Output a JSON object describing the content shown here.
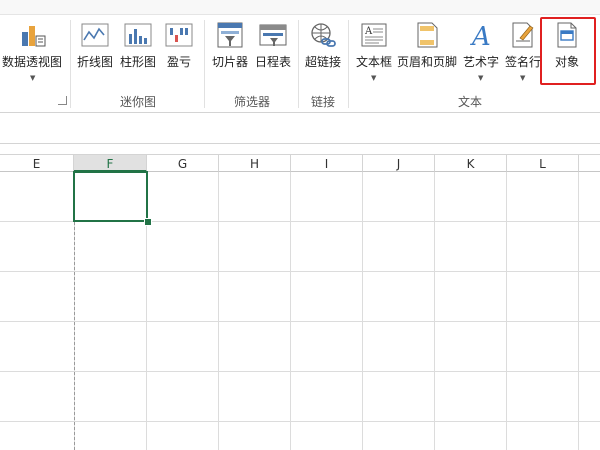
{
  "ribbon": {
    "buttons": {
      "pivot_chart": "数据透视图",
      "line": "折线图",
      "column": "柱形图",
      "winloss": "盈亏",
      "slicer": "切片器",
      "timeline": "日程表",
      "hyperlink": "超链接",
      "textbox": "文本框",
      "header_footer": "页眉和页脚",
      "wordart": "艺术字",
      "signature": "签名行",
      "object": "对象"
    },
    "groups": {
      "sparklines": "迷你图",
      "filters": "筛选器",
      "links": "链接",
      "text": "文本"
    }
  },
  "grid": {
    "columns": [
      "E",
      "F",
      "G",
      "H",
      "I",
      "J",
      "K",
      "L"
    ],
    "selected_column": "F"
  },
  "colors": {
    "excel_green": "#217346",
    "highlight_red": "#e02020"
  }
}
